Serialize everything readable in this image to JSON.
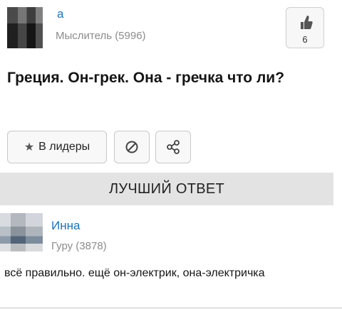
{
  "question": {
    "author_name": "а",
    "author_rank": "Мыслитель (5996)",
    "like_count": "6",
    "text": "Греция. Он-грек. Она - гречка что ли?"
  },
  "actions": {
    "leaders_label": "В лидеры"
  },
  "best_answer": {
    "header": "ЛУЧШИЙ ОТВЕТ",
    "author_name": "Инна",
    "author_rank": "Гуру (3878)",
    "text": "всё правильно. ещё он-электрик, она-электричка"
  },
  "icons": {
    "like": "thumbs-up-icon",
    "star": "star-icon",
    "report": "block-icon",
    "share": "share-icon"
  },
  "colors": {
    "link": "#1a73b8",
    "muted": "#8c8c8c",
    "header_bar": "#e3e3e3"
  }
}
